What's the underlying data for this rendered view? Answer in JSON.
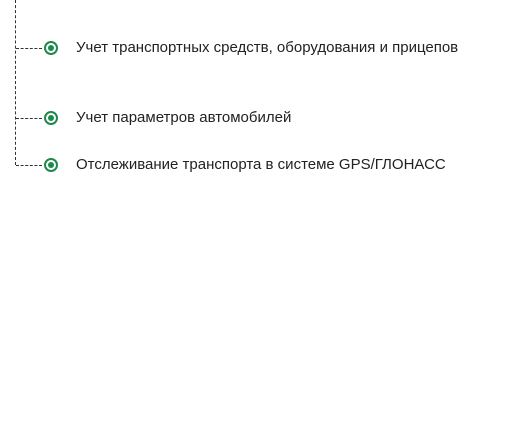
{
  "tree": {
    "accent_color": "#1b8a4a",
    "items": [
      {
        "label": "Учет транспортных средств, оборудования и прицепов",
        "selected": true,
        "icon": "radio-selected-icon"
      },
      {
        "label": "Учет параметров автомобилей",
        "selected": true,
        "icon": "radio-selected-icon"
      },
      {
        "label": "Отслеживание транспорта в системе GPS/ГЛОНАСС",
        "selected": true,
        "icon": "radio-selected-icon"
      }
    ]
  }
}
